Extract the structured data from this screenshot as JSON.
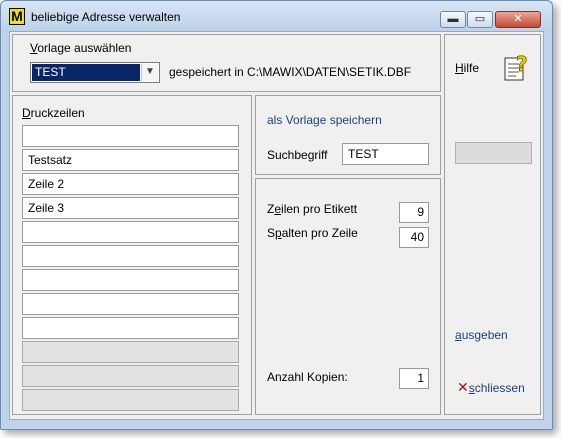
{
  "window": {
    "title": "beliebige Adresse verwalten",
    "icon_letter": "M",
    "minimize_symbol": "▬",
    "maximize_symbol": "▭",
    "close_symbol": "✕"
  },
  "top": {
    "vorlage_label": "Vorlage auswählen",
    "vorlage_value": "TEST",
    "saved_in_text": "gespeichert in C:\\MAWIX\\DATEN\\SETIK.DBF"
  },
  "druckzeilen": {
    "label": "Druckzeilen",
    "rows": [
      {
        "value": "",
        "disabled": false
      },
      {
        "value": "Testsatz",
        "disabled": false
      },
      {
        "value": "Zeile 2",
        "disabled": false
      },
      {
        "value": "Zeile 3",
        "disabled": false
      },
      {
        "value": "",
        "disabled": false
      },
      {
        "value": "",
        "disabled": false
      },
      {
        "value": "",
        "disabled": false
      },
      {
        "value": "",
        "disabled": false
      },
      {
        "value": "",
        "disabled": false
      },
      {
        "value": "",
        "disabled": true
      },
      {
        "value": "",
        "disabled": true
      },
      {
        "value": "",
        "disabled": true
      }
    ]
  },
  "template": {
    "save_link": "als Vorlage speichern",
    "suchbegriff_label": "Suchbegriff",
    "suchbegriff_value": "TEST"
  },
  "settings": {
    "zeilen_label": "Zeilen pro Etikett",
    "zeilen_value": "9",
    "spalten_label": "Spalten pro Zeile",
    "spalten_value": "40",
    "kopien_label": "Anzahl Kopien:",
    "kopien_value": "1"
  },
  "right": {
    "hilfe_label": "Hilfe",
    "ausgeben_label": "ausgeben",
    "schliessen_label": "schliessen"
  }
}
